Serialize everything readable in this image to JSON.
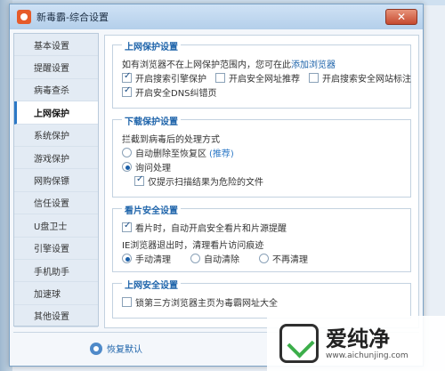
{
  "window": {
    "title": "新毒霸-综合设置",
    "close_glyph": "✕"
  },
  "sidebar": {
    "items": [
      {
        "label": "基本设置"
      },
      {
        "label": "提醒设置"
      },
      {
        "label": "病毒查杀"
      },
      {
        "label": "上网保护",
        "active": true
      },
      {
        "label": "系统保护"
      },
      {
        "label": "游戏保护"
      },
      {
        "label": "网购保镖"
      },
      {
        "label": "信任设置"
      },
      {
        "label": "U盘卫士"
      },
      {
        "label": "引擎设置"
      },
      {
        "label": "手机助手"
      },
      {
        "label": "加速球"
      },
      {
        "label": "其他设置"
      }
    ]
  },
  "sections": {
    "web_protection": {
      "title": "上网保护设置",
      "note": "如有浏览器不在上网保护范围内，您可在此",
      "note_link": "添加浏览器",
      "opt_search_engine": "开启搜索引擎保护",
      "opt_safe_url": "开启安全网址推荐",
      "opt_search_mark": "开启搜索安全网站标注",
      "opt_dns": "开启安全DNS纠错页"
    },
    "download_protection": {
      "title": "下载保护设置",
      "prompt": "拦截到病毒后的处理方式",
      "opt_auto_delete": "自动删除至恢复区",
      "recommend": "(推荐)",
      "opt_ask": "询问处理",
      "opt_prompt_only": "仅提示扫描结果为危险的文件"
    },
    "movie_safety": {
      "title": "看片安全设置",
      "opt_auto_enable": "看片时，自动开启安全看片和片源提醒",
      "ie_label": "IE浏览器退出时，清理看片访问痕迹",
      "opt_manual": "手动清理",
      "opt_auto": "自动清除",
      "opt_never": "不再清理"
    },
    "web_safety": {
      "title": "上网安全设置",
      "opt_lock_homepage": "锁第三方浏览器主页为毒霸网址大全"
    }
  },
  "footer": {
    "restore_label": "恢复默认"
  },
  "watermark": {
    "brand": "爱纯净",
    "url": "www.aichunjing.com"
  }
}
